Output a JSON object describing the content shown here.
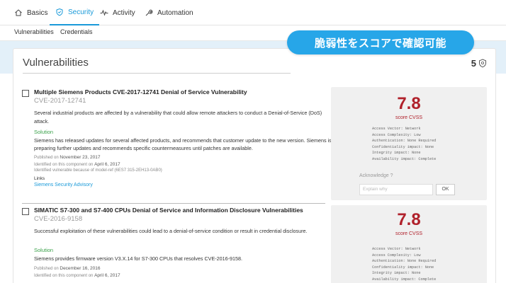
{
  "tabs": [
    {
      "label": "Basics",
      "icon": "home-icon"
    },
    {
      "label": "Security",
      "icon": "shield-icon",
      "active": true
    },
    {
      "label": "Activity",
      "icon": "pulse-icon"
    },
    {
      "label": "Automation",
      "icon": "wrench-icon"
    }
  ],
  "subtabs": [
    "Vulnerabilities",
    "Credentials"
  ],
  "banner": "脆弱性をスコアで確認可能",
  "panel": {
    "title": "Vulnerabilities",
    "count": "5",
    "count_icon": "shield-icon"
  },
  "vulns": [
    {
      "title": "Multiple Siemens Products CVE-2017-12741 Denial of Service Vulnerability",
      "cve": "CVE-2017-12741",
      "description": "Several industrial products are affected by a vulnerability that could allow remote attackers to conduct a Denial-of-Service (DoS) attack.",
      "solution_label": "Solution",
      "solution": "Siemens has released updates for several affected products, and recommends that customer update to the new version. Siemens is preparing further updates and recommends specific countermeasures until patches are available.",
      "published_prefix": "Published on ",
      "published": "November 23, 2017",
      "identified_prefix": "Identified on this component on ",
      "identified": "April 6, 2017",
      "identified_because": "Identified vulnerable because of model-ref (6ES7 315-2EH13-0AB0)",
      "links_label": "Links",
      "link": "Siemens Security Advisory",
      "score": "7.8",
      "score_label": "score CVSS",
      "metrics": [
        "Access Vector: Network",
        "Access Complexity: Low",
        "Authentication: None Required",
        "Confidentiality impact: None",
        "Integrity impact: None",
        "Availability impact: Complete"
      ],
      "acknowledge_label": "Acknowledge ?",
      "acknowledge_placeholder": "Explain why",
      "ok_label": "OK"
    },
    {
      "title": "SIMATIC S7-300 and S7-400 CPUs Denial of Service and Information Disclosure Vulnerabilities",
      "cve": "CVE-2016-9158",
      "description": "Successful exploitation of these vulnerabilities could lead to a denial-of-service condition or result in credential disclosure.",
      "solution_label": "Solution",
      "solution": "Siemens provides firmware version V3.X.14 for S7-300 CPUs that resolves CVE-2016-9158.",
      "published_prefix": "Published on ",
      "published": "December 16, 2016",
      "identified_prefix": "Identified on this component on ",
      "identified": "April 6, 2017",
      "score": "7.8",
      "score_label": "score CVSS",
      "metrics": [
        "Access Vector: Network",
        "Access Complexity: Low",
        "Authentication: None Required",
        "Confidentiality impact: None",
        "Integrity impact: None",
        "Availability impact: Complete"
      ]
    }
  ]
}
